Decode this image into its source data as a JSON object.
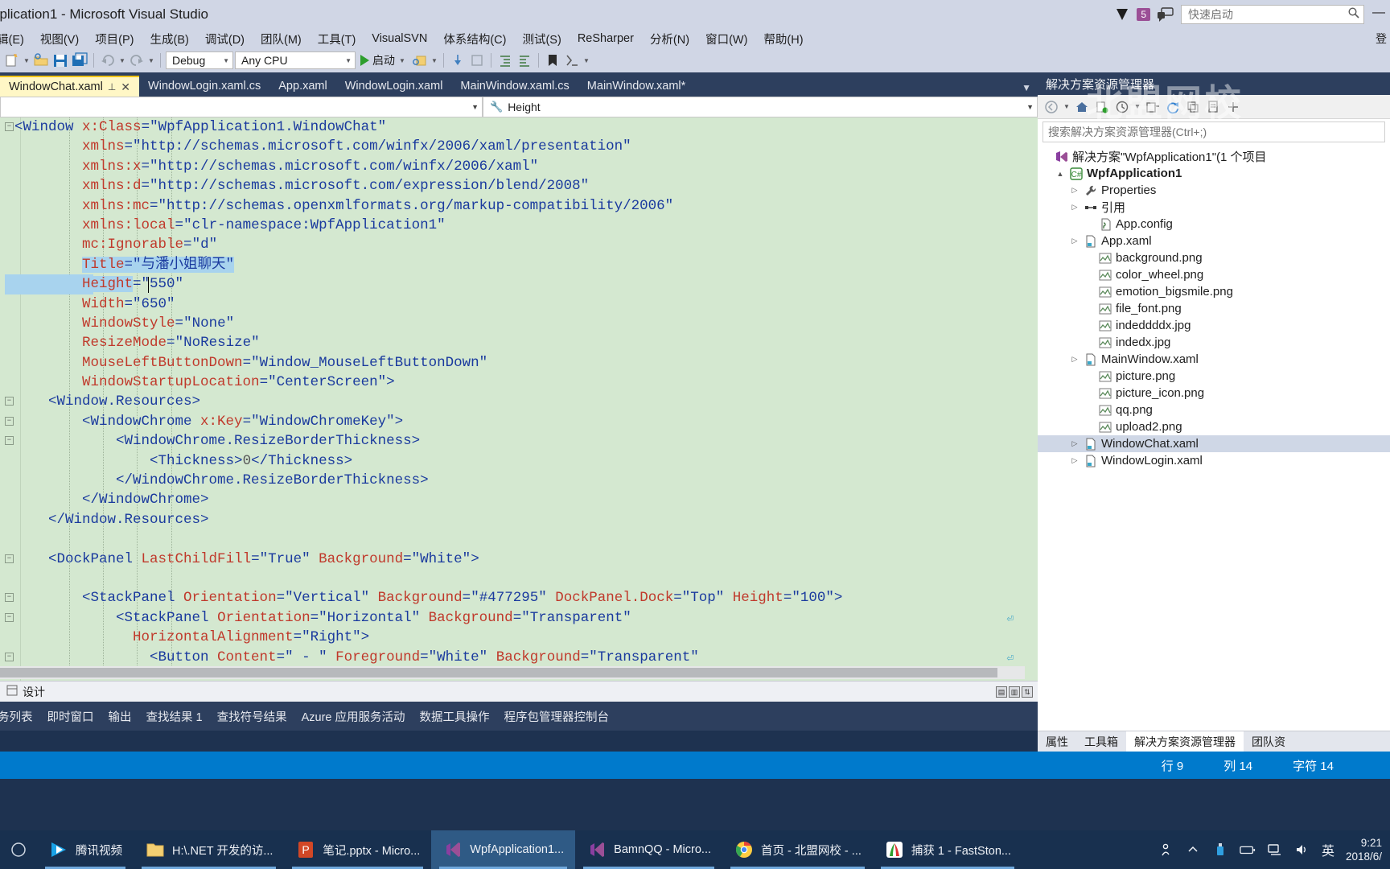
{
  "window": {
    "title": "pplication1 - Microsoft Visual Studio",
    "notification_count": "5",
    "minimize": "—"
  },
  "quick_launch": {
    "placeholder": "快速启动",
    "icon": "search-icon"
  },
  "menu": {
    "items": [
      "辑(E)",
      "视图(V)",
      "项目(P)",
      "生成(B)",
      "调试(D)",
      "团队(M)",
      "工具(T)",
      "VisualSVN",
      "体系结构(C)",
      "测试(S)",
      "ReSharper",
      "分析(N)",
      "窗口(W)",
      "帮助(H)"
    ],
    "right_label": "登"
  },
  "toolbar": {
    "configuration": "Debug",
    "platform": "Any CPU",
    "start_label": "启动"
  },
  "tabs": [
    {
      "label": "WindowChat.xaml",
      "active": true,
      "pin": "⊥",
      "close": "✕"
    },
    {
      "label": "WindowLogin.xaml.cs",
      "active": false
    },
    {
      "label": "App.xaml",
      "active": false
    },
    {
      "label": "WindowLogin.xaml",
      "active": false
    },
    {
      "label": "MainWindow.xaml.cs",
      "active": false
    },
    {
      "label": "MainWindow.xaml*",
      "active": false
    }
  ],
  "navbar": {
    "left_value": "",
    "right_value": "Height"
  },
  "code": {
    "lines": [
      [
        {
          "t": "<",
          "c": "pn"
        },
        {
          "t": "Window",
          "c": "el"
        },
        {
          "t": " ",
          "c": "tx"
        },
        {
          "t": "x:Class",
          "c": "at"
        },
        {
          "t": "=",
          "c": "pn"
        },
        {
          "t": "\"WpfApplication1.WindowChat\"",
          "c": "st"
        }
      ],
      [
        {
          "t": "        ",
          "c": "tx"
        },
        {
          "t": "xmlns",
          "c": "at"
        },
        {
          "t": "=",
          "c": "pn"
        },
        {
          "t": "\"http://schemas.microsoft.com/winfx/2006/xaml/presentation\"",
          "c": "st"
        }
      ],
      [
        {
          "t": "        ",
          "c": "tx"
        },
        {
          "t": "xmlns:x",
          "c": "at"
        },
        {
          "t": "=",
          "c": "pn"
        },
        {
          "t": "\"http://schemas.microsoft.com/winfx/2006/xaml\"",
          "c": "st"
        }
      ],
      [
        {
          "t": "        ",
          "c": "tx"
        },
        {
          "t": "xmlns:d",
          "c": "at"
        },
        {
          "t": "=",
          "c": "pn"
        },
        {
          "t": "\"http://schemas.microsoft.com/expression/blend/2008\"",
          "c": "st"
        }
      ],
      [
        {
          "t": "        ",
          "c": "tx"
        },
        {
          "t": "xmlns:mc",
          "c": "at"
        },
        {
          "t": "=",
          "c": "pn"
        },
        {
          "t": "\"http://schemas.openxmlformats.org/markup-compatibility/2006\"",
          "c": "st"
        }
      ],
      [
        {
          "t": "        ",
          "c": "tx"
        },
        {
          "t": "xmlns:local",
          "c": "at"
        },
        {
          "t": "=",
          "c": "pn"
        },
        {
          "t": "\"clr-namespace:WpfApplication1\"",
          "c": "st"
        }
      ],
      [
        {
          "t": "        ",
          "c": "tx"
        },
        {
          "t": "mc:Ignorable",
          "c": "at"
        },
        {
          "t": "=",
          "c": "pn"
        },
        {
          "t": "\"d\"",
          "c": "st"
        }
      ],
      [
        {
          "t": "        ",
          "c": "tx"
        },
        {
          "t": "Title",
          "c": "at"
        },
        {
          "t": "=",
          "c": "pn"
        },
        {
          "t": "\"与潘小姐聊天\"",
          "c": "st"
        }
      ],
      [
        {
          "t": "        ",
          "c": "tx"
        },
        {
          "t": "Height",
          "c": "at"
        },
        {
          "t": "=",
          "c": "pn"
        },
        {
          "t": "\"550\"",
          "c": "st"
        }
      ],
      [
        {
          "t": "        ",
          "c": "tx"
        },
        {
          "t": "Width",
          "c": "at"
        },
        {
          "t": "=",
          "c": "pn"
        },
        {
          "t": "\"650\"",
          "c": "st"
        }
      ],
      [
        {
          "t": "        ",
          "c": "tx"
        },
        {
          "t": "WindowStyle",
          "c": "at"
        },
        {
          "t": "=",
          "c": "pn"
        },
        {
          "t": "\"None\"",
          "c": "st"
        }
      ],
      [
        {
          "t": "        ",
          "c": "tx"
        },
        {
          "t": "ResizeMode",
          "c": "at"
        },
        {
          "t": "=",
          "c": "pn"
        },
        {
          "t": "\"NoResize\"",
          "c": "st"
        }
      ],
      [
        {
          "t": "        ",
          "c": "tx"
        },
        {
          "t": "MouseLeftButtonDown",
          "c": "at"
        },
        {
          "t": "=",
          "c": "pn"
        },
        {
          "t": "\"Window_MouseLeftButtonDown\"",
          "c": "st"
        }
      ],
      [
        {
          "t": "        ",
          "c": "tx"
        },
        {
          "t": "WindowStartupLocation",
          "c": "at"
        },
        {
          "t": "=",
          "c": "pn"
        },
        {
          "t": "\"CenterScreen\"",
          "c": "st"
        },
        {
          "t": ">",
          "c": "pn"
        }
      ],
      [
        {
          "t": "    ",
          "c": "tx"
        },
        {
          "t": "<Window.Resources>",
          "c": "el"
        }
      ],
      [
        {
          "t": "        ",
          "c": "tx"
        },
        {
          "t": "<WindowChrome ",
          "c": "el"
        },
        {
          "t": "x:Key",
          "c": "at"
        },
        {
          "t": "=",
          "c": "pn"
        },
        {
          "t": "\"WindowChromeKey\"",
          "c": "st"
        },
        {
          "t": ">",
          "c": "pn"
        }
      ],
      [
        {
          "t": "            ",
          "c": "tx"
        },
        {
          "t": "<WindowChrome.ResizeBorderThickness>",
          "c": "el"
        }
      ],
      [
        {
          "t": "                ",
          "c": "tx"
        },
        {
          "t": "<Thickness>",
          "c": "el"
        },
        {
          "t": "0",
          "c": "tx"
        },
        {
          "t": "</Thickness>",
          "c": "el"
        }
      ],
      [
        {
          "t": "            ",
          "c": "tx"
        },
        {
          "t": "</WindowChrome.ResizeBorderThickness>",
          "c": "el"
        }
      ],
      [
        {
          "t": "        ",
          "c": "tx"
        },
        {
          "t": "</WindowChrome>",
          "c": "el"
        }
      ],
      [
        {
          "t": "    ",
          "c": "tx"
        },
        {
          "t": "</Window.Resources>",
          "c": "el"
        }
      ],
      [],
      [
        {
          "t": "    ",
          "c": "tx"
        },
        {
          "t": "<DockPanel ",
          "c": "el"
        },
        {
          "t": "LastChildFill",
          "c": "at"
        },
        {
          "t": "=",
          "c": "pn"
        },
        {
          "t": "\"True\"",
          "c": "st"
        },
        {
          "t": " ",
          "c": "tx"
        },
        {
          "t": "Background",
          "c": "at"
        },
        {
          "t": "=",
          "c": "pn"
        },
        {
          "t": "\"White\"",
          "c": "st"
        },
        {
          "t": ">",
          "c": "pn"
        }
      ],
      [],
      [
        {
          "t": "        ",
          "c": "tx"
        },
        {
          "t": "<StackPanel ",
          "c": "el"
        },
        {
          "t": "Orientation",
          "c": "at"
        },
        {
          "t": "=",
          "c": "pn"
        },
        {
          "t": "\"Vertical\"",
          "c": "st"
        },
        {
          "t": " ",
          "c": "tx"
        },
        {
          "t": "Background",
          "c": "at"
        },
        {
          "t": "=",
          "c": "pn"
        },
        {
          "t": "\"#477295\"",
          "c": "st"
        },
        {
          "t": " ",
          "c": "tx"
        },
        {
          "t": "DockPanel.Dock",
          "c": "at"
        },
        {
          "t": "=",
          "c": "pn"
        },
        {
          "t": "\"Top\"",
          "c": "st"
        },
        {
          "t": " ",
          "c": "tx"
        },
        {
          "t": "Height",
          "c": "at"
        },
        {
          "t": "=",
          "c": "pn"
        },
        {
          "t": "\"100\"",
          "c": "st"
        },
        {
          "t": ">",
          "c": "pn"
        }
      ],
      [
        {
          "t": "            ",
          "c": "tx"
        },
        {
          "t": "<StackPanel ",
          "c": "el"
        },
        {
          "t": "Orientation",
          "c": "at"
        },
        {
          "t": "=",
          "c": "pn"
        },
        {
          "t": "\"Horizontal\"",
          "c": "st"
        },
        {
          "t": " ",
          "c": "tx"
        },
        {
          "t": "Background",
          "c": "at"
        },
        {
          "t": "=",
          "c": "pn"
        },
        {
          "t": "\"Transparent\"",
          "c": "st"
        }
      ],
      [
        {
          "t": "              ",
          "c": "tx"
        },
        {
          "t": "HorizontalAlignment",
          "c": "at"
        },
        {
          "t": "=",
          "c": "pn"
        },
        {
          "t": "\"Right\"",
          "c": "st"
        },
        {
          "t": ">",
          "c": "pn"
        }
      ],
      [
        {
          "t": "                ",
          "c": "tx"
        },
        {
          "t": "<Button ",
          "c": "el"
        },
        {
          "t": "Content",
          "c": "at"
        },
        {
          "t": "=",
          "c": "pn"
        },
        {
          "t": "\" - \"",
          "c": "st"
        },
        {
          "t": " ",
          "c": "tx"
        },
        {
          "t": "Foreground",
          "c": "at"
        },
        {
          "t": "=",
          "c": "pn"
        },
        {
          "t": "\"White\"",
          "c": "st"
        },
        {
          "t": " ",
          "c": "tx"
        },
        {
          "t": "Background",
          "c": "at"
        },
        {
          "t": "=",
          "c": "pn"
        },
        {
          "t": "\"Transparent\"",
          "c": "st"
        }
      ]
    ]
  },
  "design_bar": {
    "label": "设计"
  },
  "bottom_tabs": [
    "务列表",
    "即时窗口",
    "输出",
    "查找结果 1",
    "查找符号结果",
    "Azure 应用服务活动",
    "数据工具操作",
    "程序包管理器控制台"
  ],
  "solution_explorer": {
    "title": "解决方案资源管理器",
    "search_placeholder": "搜索解决方案资源管理器(Ctrl+;)",
    "watermark": "北盟网校",
    "tree": [
      {
        "label": "解决方案\"WpfApplication1\"(1 个项目",
        "indent": 0,
        "tri": "",
        "icon": "solution-icon",
        "bold": false,
        "selected": false
      },
      {
        "label": "WpfApplication1",
        "indent": 1,
        "tri": "▲",
        "icon": "csharp-project-icon",
        "bold": true,
        "selected": false
      },
      {
        "label": "Properties",
        "indent": 2,
        "tri": "▷",
        "icon": "wrench-icon",
        "bold": false,
        "selected": false
      },
      {
        "label": "引用",
        "indent": 2,
        "tri": "▷",
        "icon": "references-icon",
        "bold": false,
        "selected": false
      },
      {
        "label": "App.config",
        "indent": 3,
        "tri": "",
        "icon": "config-icon",
        "bold": false,
        "selected": false
      },
      {
        "label": "App.xaml",
        "indent": 2,
        "tri": "▷",
        "icon": "xaml-icon",
        "bold": false,
        "selected": false
      },
      {
        "label": "background.png",
        "indent": 3,
        "tri": "",
        "icon": "image-icon",
        "bold": false,
        "selected": false
      },
      {
        "label": "color_wheel.png",
        "indent": 3,
        "tri": "",
        "icon": "image-icon",
        "bold": false,
        "selected": false
      },
      {
        "label": "emotion_bigsmile.png",
        "indent": 3,
        "tri": "",
        "icon": "image-icon",
        "bold": false,
        "selected": false
      },
      {
        "label": "file_font.png",
        "indent": 3,
        "tri": "",
        "icon": "image-icon",
        "bold": false,
        "selected": false
      },
      {
        "label": "indeddddx.jpg",
        "indent": 3,
        "tri": "",
        "icon": "image-icon",
        "bold": false,
        "selected": false
      },
      {
        "label": "indedx.jpg",
        "indent": 3,
        "tri": "",
        "icon": "image-icon",
        "bold": false,
        "selected": false
      },
      {
        "label": "MainWindow.xaml",
        "indent": 2,
        "tri": "▷",
        "icon": "xaml-icon",
        "bold": false,
        "selected": false
      },
      {
        "label": "picture.png",
        "indent": 3,
        "tri": "",
        "icon": "image-icon",
        "bold": false,
        "selected": false
      },
      {
        "label": "picture_icon.png",
        "indent": 3,
        "tri": "",
        "icon": "image-icon",
        "bold": false,
        "selected": false
      },
      {
        "label": "qq.png",
        "indent": 3,
        "tri": "",
        "icon": "image-icon",
        "bold": false,
        "selected": false
      },
      {
        "label": "upload2.png",
        "indent": 3,
        "tri": "",
        "icon": "image-icon",
        "bold": false,
        "selected": false
      },
      {
        "label": "WindowChat.xaml",
        "indent": 2,
        "tri": "▷",
        "icon": "xaml-icon",
        "bold": false,
        "selected": true
      },
      {
        "label": "WindowLogin.xaml",
        "indent": 2,
        "tri": "▷",
        "icon": "xaml-icon",
        "bold": false,
        "selected": false
      }
    ],
    "panel_tabs": [
      {
        "label": "属性",
        "active": false
      },
      {
        "label": "工具箱",
        "active": false
      },
      {
        "label": "解决方案资源管理器",
        "active": true
      },
      {
        "label": "团队资",
        "active": false
      }
    ]
  },
  "status_bar": {
    "line": "行 9",
    "column": "列 14",
    "character": "字符 14"
  },
  "taskbar": {
    "items": [
      {
        "label": "腾讯视频",
        "icon": "tencent-video-icon",
        "active": false
      },
      {
        "label": "H:\\.NET 开发的访...",
        "icon": "folder-icon",
        "active": false
      },
      {
        "label": "笔记.pptx - Micro...",
        "icon": "powerpoint-icon",
        "active": false
      },
      {
        "label": "WpfApplication1...",
        "icon": "visual-studio-icon",
        "active": true
      },
      {
        "label": "BamnQQ - Micro...",
        "icon": "visual-studio-icon",
        "active": false
      },
      {
        "label": "首页 - 北盟网校 - ...",
        "icon": "chrome-icon",
        "active": false
      },
      {
        "label": "捕获 1 - FastSton...",
        "icon": "faststone-icon",
        "active": false
      }
    ],
    "ime": "英",
    "clock_time": "9:21",
    "clock_date": "2018/6/"
  }
}
